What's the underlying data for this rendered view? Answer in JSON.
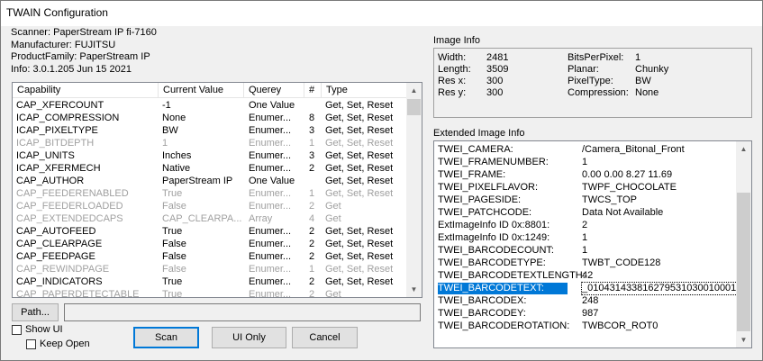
{
  "window": {
    "title": "TWAIN Configuration"
  },
  "scanner_info": [
    "Scanner: PaperStream IP fi-7160",
    "Manufacturer: FUJITSU",
    "ProductFamily: PaperStream IP",
    "Info: 3.0.1.205 Jun 15 2021"
  ],
  "capabilities": {
    "headers": [
      "Capability",
      "Current Value",
      "Querey",
      "#",
      "Type"
    ],
    "rows": [
      {
        "cap": "CAP_XFERCOUNT",
        "value": "-1",
        "query": "One Value",
        "n": "",
        "type": "Get, Set, Reset",
        "enabled": true
      },
      {
        "cap": "ICAP_COMPRESSION",
        "value": "None",
        "query": "Enumer...",
        "n": "8",
        "type": "Get, Set, Reset",
        "enabled": true
      },
      {
        "cap": "ICAP_PIXELTYPE",
        "value": "BW",
        "query": "Enumer...",
        "n": "3",
        "type": "Get, Set, Reset",
        "enabled": true
      },
      {
        "cap": "ICAP_BITDEPTH",
        "value": "1",
        "query": "Enumer...",
        "n": "1",
        "type": "Get, Set, Reset",
        "enabled": false
      },
      {
        "cap": "ICAP_UNITS",
        "value": "Inches",
        "query": "Enumer...",
        "n": "3",
        "type": "Get, Set, Reset",
        "enabled": true
      },
      {
        "cap": "ICAP_XFERMECH",
        "value": "Native",
        "query": "Enumer...",
        "n": "2",
        "type": "Get, Set, Reset",
        "enabled": true
      },
      {
        "cap": "CAP_AUTHOR",
        "value": "PaperStream IP",
        "query": "One Value",
        "n": "",
        "type": "Get, Set, Reset",
        "enabled": true
      },
      {
        "cap": "CAP_FEEDERENABLED",
        "value": "True",
        "query": "Enumer...",
        "n": "1",
        "type": "Get, Set, Reset",
        "enabled": false
      },
      {
        "cap": "CAP_FEEDERLOADED",
        "value": "False",
        "query": "Enumer...",
        "n": "2",
        "type": "Get",
        "enabled": false
      },
      {
        "cap": "CAP_EXTENDEDCAPS",
        "value": "CAP_CLEARPA...",
        "query": "Array",
        "n": "4",
        "type": "Get",
        "enabled": false
      },
      {
        "cap": "CAP_AUTOFEED",
        "value": "True",
        "query": "Enumer...",
        "n": "2",
        "type": "Get, Set, Reset",
        "enabled": true
      },
      {
        "cap": "CAP_CLEARPAGE",
        "value": "False",
        "query": "Enumer...",
        "n": "2",
        "type": "Get, Set, Reset",
        "enabled": true
      },
      {
        "cap": "CAP_FEEDPAGE",
        "value": "False",
        "query": "Enumer...",
        "n": "2",
        "type": "Get, Set, Reset",
        "enabled": true
      },
      {
        "cap": "CAP_REWINDPAGE",
        "value": "False",
        "query": "Enumer...",
        "n": "1",
        "type": "Get, Set, Reset",
        "enabled": false
      },
      {
        "cap": "CAP_INDICATORS",
        "value": "True",
        "query": "Enumer...",
        "n": "2",
        "type": "Get, Set, Reset",
        "enabled": true
      },
      {
        "cap": "CAP_PAPERDETECTABLE",
        "value": "True",
        "query": "Enumer...",
        "n": "2",
        "type": "Get",
        "enabled": false
      }
    ]
  },
  "controls": {
    "path_label": "Path...",
    "path_value": "",
    "show_ui_label": "Show UI",
    "keep_open_label": "Keep Open",
    "scan_label": "Scan",
    "ui_only_label": "UI Only",
    "cancel_label": "Cancel"
  },
  "image_info": {
    "label": "Image Info",
    "left": [
      {
        "k": "Width:",
        "v": "2481"
      },
      {
        "k": "Length:",
        "v": "3509"
      },
      {
        "k": "Res x:",
        "v": "300"
      },
      {
        "k": "Res y:",
        "v": "300"
      }
    ],
    "right": [
      {
        "k": "BitsPerPixel:",
        "v": "1"
      },
      {
        "k": "Planar:",
        "v": "Chunky"
      },
      {
        "k": "PixelType:",
        "v": "BW"
      },
      {
        "k": "Compression:",
        "v": "None"
      }
    ]
  },
  "extended_info": {
    "label": "Extended Image Info",
    "rows": [
      {
        "k": "TWEI_CAMERA:",
        "v": "/Camera_Bitonal_Front"
      },
      {
        "k": "TWEI_FRAMENUMBER:",
        "v": "1"
      },
      {
        "k": "TWEI_FRAME:",
        "v": "0.00  0.00  8.27  11.69"
      },
      {
        "k": "TWEI_PIXELFLAVOR:",
        "v": "TWPF_CHOCOLATE"
      },
      {
        "k": "TWEI_PAGESIDE:",
        "v": "TWCS_TOP"
      },
      {
        "k": "TWEI_PATCHCODE:",
        "v": "Data Not Available"
      },
      {
        "k": "ExtImageInfo ID 0x:8801:",
        "v": "2"
      },
      {
        "k": "ExtImageInfo ID 0x:1249:",
        "v": "1"
      },
      {
        "k": "TWEI_BARCODECOUNT:",
        "v": "1"
      },
      {
        "k": "TWEI_BARCODETYPE:",
        "v": "TWBT_CODE128"
      },
      {
        "k": "TWEI_BARCODETEXTLENGTH:",
        "v": "42"
      },
      {
        "k": "TWEI_BARCODETEXT:",
        "v": "_010431433816279531030010001"
      },
      {
        "k": "TWEI_BARCODEX:",
        "v": "248"
      },
      {
        "k": "TWEI_BARCODEY:",
        "v": "987"
      },
      {
        "k": "TWEI_BARCODEROTATION:",
        "v": "TWBCOR_ROT0"
      }
    ]
  },
  "colors": {
    "selection": "#0078d7",
    "disabled_text": "#a0a0a0",
    "window_bg": "#f0f0f0"
  }
}
